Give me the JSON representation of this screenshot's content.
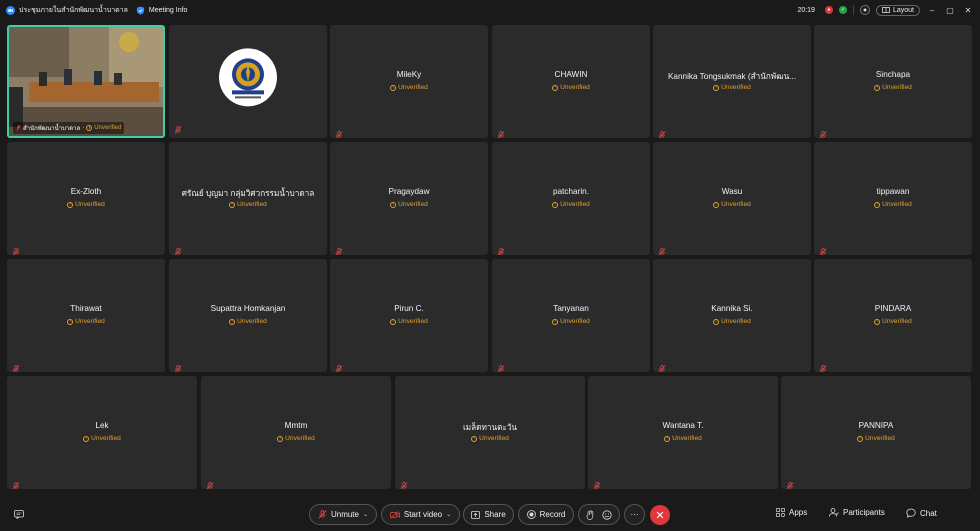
{
  "titlebar": {
    "meeting_title": "ประชุมภายในสำนักพัฒนาน้ำบาดาล",
    "meeting_info": "Meeting Info",
    "clock": "20:19",
    "layout_label": "Layout"
  },
  "self_tile": {
    "name": "สำนักพัฒนาน้ำบาดาล",
    "status": "Unverified"
  },
  "participants": [
    {
      "name": "MileKy",
      "status": "Unverified"
    },
    {
      "name": "CHAWIN",
      "status": "Unverified"
    },
    {
      "name": "Kannika Tongsukmak (สำนักพัฒน...",
      "status": "Unverified"
    },
    {
      "name": "Sinchapa",
      "status": "Unverified"
    },
    {
      "name": "Ex-Zloth",
      "status": "Unverified"
    },
    {
      "name": "ศรัณย์ บุญมา กลุ่มวิศวกรรมน้ำบาดาล",
      "status": "Unverified"
    },
    {
      "name": "Pragaydaw",
      "status": "Unverified"
    },
    {
      "name": "patcharin.",
      "status": "Unverified"
    },
    {
      "name": "Wasu",
      "status": "Unverified"
    },
    {
      "name": "tippawan",
      "status": "Unverified"
    },
    {
      "name": "Thirawat",
      "status": "Unverified"
    },
    {
      "name": "Supattra Homkanjan",
      "status": "Unverified"
    },
    {
      "name": "Pirun C.",
      "status": "Unverified"
    },
    {
      "name": "Tanyanan",
      "status": "Unverified"
    },
    {
      "name": "Kannika Si.",
      "status": "Unverified"
    },
    {
      "name": "PINDARA",
      "status": "Unverified"
    },
    {
      "name": "Lek",
      "status": "Unverified"
    },
    {
      "name": "Mmtm",
      "status": "Unverified"
    },
    {
      "name": "เมล็ดทานตะวัน",
      "status": "Unverified"
    },
    {
      "name": "Wantana T.",
      "status": "Unverified"
    },
    {
      "name": "PANNIPA",
      "status": "Unverified"
    }
  ],
  "toolbar": {
    "unmute": "Unmute",
    "start_video": "Start video",
    "share": "Share",
    "record": "Record",
    "more": "···",
    "apps": "Apps",
    "participants": "Participants",
    "chat": "Chat"
  },
  "colors": {
    "background": "#1a1a1a",
    "tile": "#2b2b2b",
    "active_border": "#3ecfa8",
    "unverified": "#e0a030",
    "leave": "#e0373f"
  }
}
